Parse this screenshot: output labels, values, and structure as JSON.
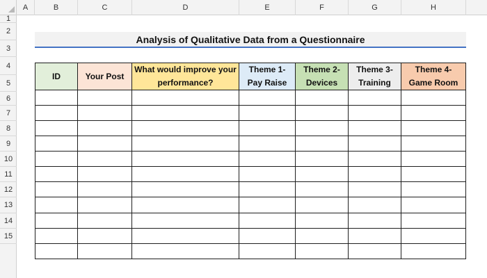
{
  "sheet": {
    "column_headers": [
      "A",
      "B",
      "C",
      "D",
      "E",
      "F",
      "G",
      "H"
    ],
    "row_headers": [
      "1",
      "2",
      "3",
      "4",
      "5",
      "6",
      "7",
      "8",
      "9",
      "10",
      "11",
      "12",
      "13",
      "14",
      "15"
    ]
  },
  "title": "Analysis of Qualitative Data from a Questionnaire",
  "table": {
    "headers": [
      {
        "label": "ID",
        "color": "#e2efda"
      },
      {
        "label": "Your Post",
        "color": "#fce4d6"
      },
      {
        "label": "What would improve your performance?",
        "color": "#ffe699"
      },
      {
        "label": "Theme 1- Pay Raise",
        "color": "#ddebf7"
      },
      {
        "label": "Theme 2- Devices",
        "color": "#c6e0b4"
      },
      {
        "label": "Theme 3- Training",
        "color": "#ededed"
      },
      {
        "label": "Theme 4- Game Room",
        "color": "#f8cbad"
      }
    ],
    "empty_rows": 11
  },
  "colors": {
    "title_underline": "#4472c4",
    "title_band": "#f2f2f2",
    "header_strip": "#f3f3f3"
  }
}
